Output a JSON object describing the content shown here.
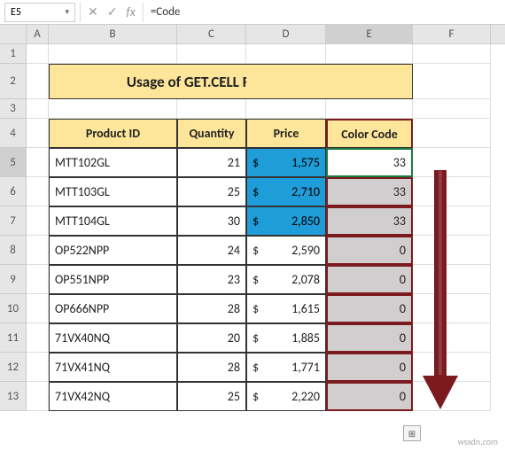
{
  "formula_bar": {
    "cell_ref": "E5",
    "formula": "=Code"
  },
  "columns": [
    "A",
    "B",
    "C",
    "D",
    "E",
    "F"
  ],
  "row_numbers": [
    1,
    2,
    3,
    4,
    5,
    6,
    7,
    8,
    9,
    10,
    11,
    12,
    13
  ],
  "sheet": {
    "title": "Usage of GET.CELL Function",
    "headers": {
      "product_id": "Product ID",
      "quantity": "Quantity",
      "price": "Price",
      "color_code": "Color Code"
    },
    "rows": [
      {
        "id": "MTT102GL",
        "qty": 21,
        "price": "1,575",
        "code": 33,
        "blue": true
      },
      {
        "id": "MTT103GL",
        "qty": 25,
        "price": "2,710",
        "code": 33,
        "blue": true
      },
      {
        "id": "MTT104GL",
        "qty": 30,
        "price": "2,850",
        "code": 33,
        "blue": true
      },
      {
        "id": "OP522NPP",
        "qty": 24,
        "price": "2,590",
        "code": 0,
        "blue": false
      },
      {
        "id": "OP551NPP",
        "qty": 23,
        "price": "2,078",
        "code": 0,
        "blue": false
      },
      {
        "id": "OP666NPP",
        "qty": 28,
        "price": "1,615",
        "code": 0,
        "blue": false
      },
      {
        "id": "71VX40NQ",
        "qty": 20,
        "price": "1,885",
        "code": 0,
        "blue": false
      },
      {
        "id": "71VX41NQ",
        "qty": 28,
        "price": "1,771",
        "code": 0,
        "blue": false
      },
      {
        "id": "71VX42NQ",
        "qty": 25,
        "price": "2,220",
        "code": 0,
        "blue": false
      }
    ],
    "currency": "$"
  },
  "icons": {
    "dropdown": "▾",
    "cancel": "✕",
    "confirm": "✓",
    "fx": "fx",
    "fill": "⊞"
  },
  "watermark": "wsxdn.com"
}
